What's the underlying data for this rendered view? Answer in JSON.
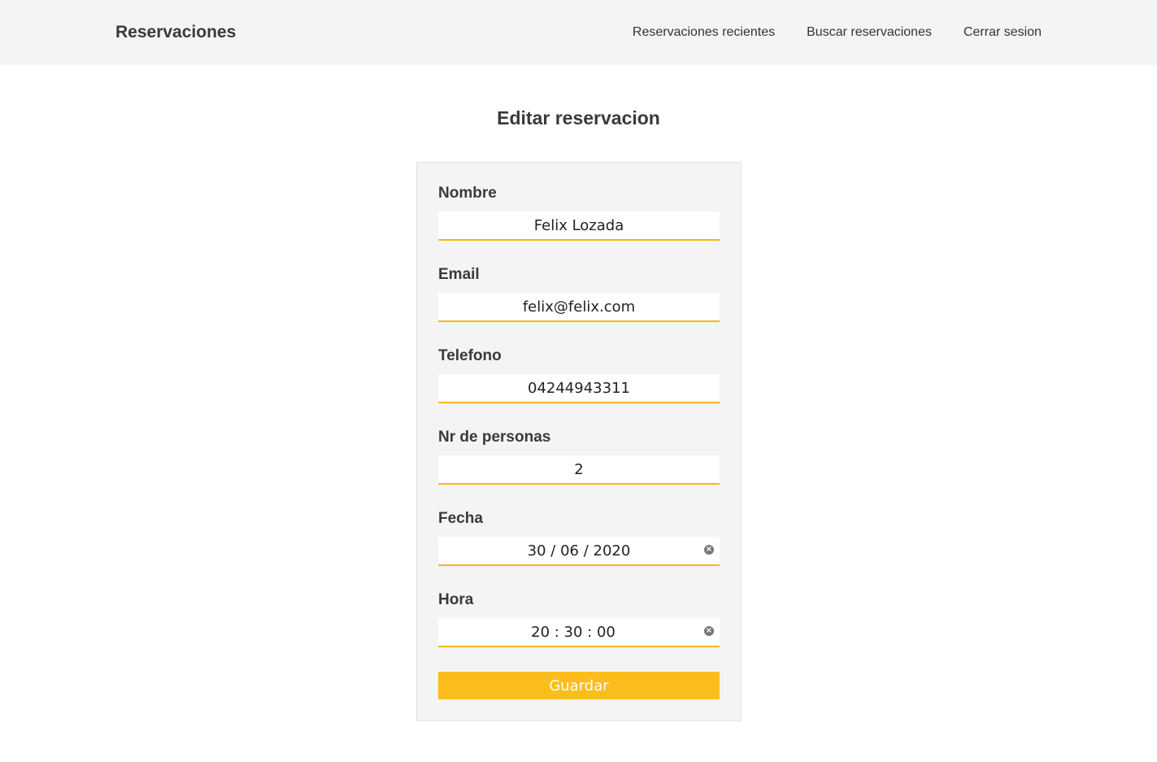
{
  "header": {
    "brand": "Reservaciones",
    "nav": [
      {
        "label": "Reservaciones recientes"
      },
      {
        "label": "Buscar reservaciones"
      },
      {
        "label": "Cerrar sesion"
      }
    ]
  },
  "page": {
    "title": "Editar reservacion"
  },
  "form": {
    "fields": [
      {
        "label": "Nombre",
        "value": "Felix Lozada"
      },
      {
        "label": "Email",
        "value": "felix@felix.com"
      },
      {
        "label": "Telefono",
        "value": "04244943311"
      },
      {
        "label": "Nr de personas",
        "value": "2"
      },
      {
        "label": "Fecha",
        "value": "30 / 06 / 2020",
        "icon": "clear-icon"
      },
      {
        "label": "Hora",
        "value": "20 : 30 : 00",
        "icon": "clear-icon"
      }
    ],
    "submit_label": "Guardar"
  },
  "colors": {
    "accent": "#fbbd1c",
    "underline": "#f5b81a",
    "header_bg": "#f4f4f4",
    "card_bg": "#f4f4f4"
  }
}
